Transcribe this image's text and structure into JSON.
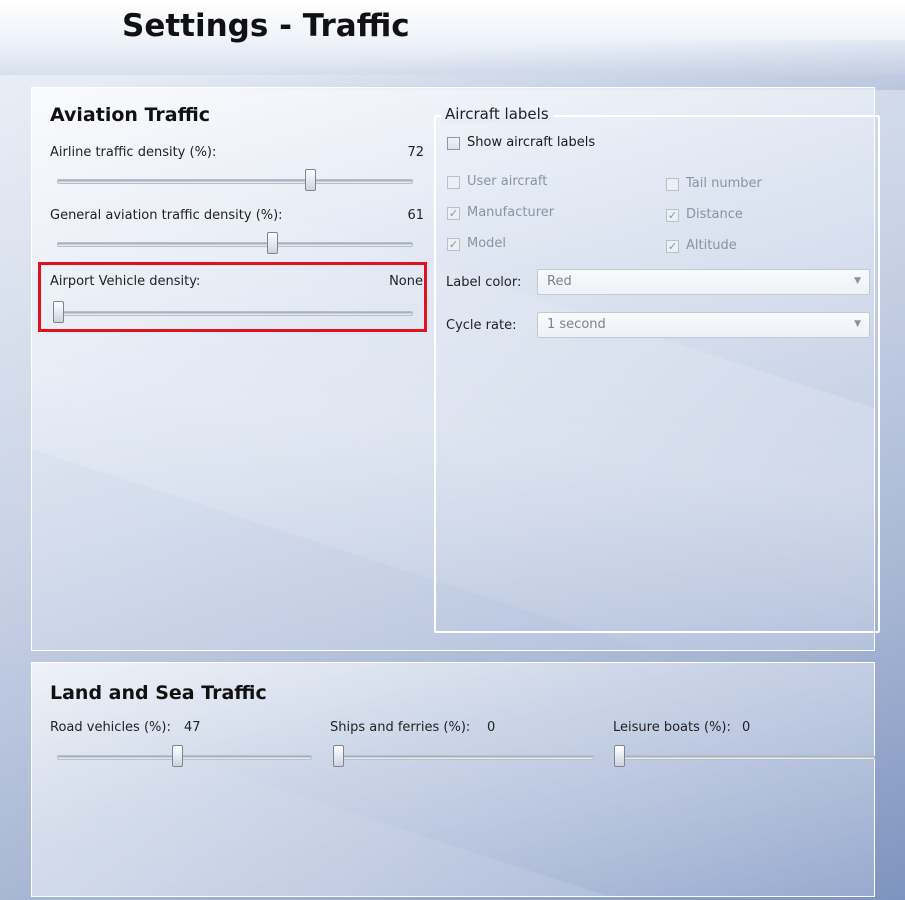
{
  "window": {
    "title": "Settings - Traffic"
  },
  "aviation": {
    "title": "Aviation Traffic",
    "airline": {
      "label": "Airline traffic density (%):",
      "value": "72",
      "level": 72
    },
    "general": {
      "label": "General aviation traffic density (%):",
      "value": "61",
      "level": 61
    },
    "airport_vehicle": {
      "label": "Airport Vehicle density:",
      "value": "None",
      "level": 0
    }
  },
  "aircraft_labels": {
    "legend": "Aircraft labels",
    "show_labels": {
      "label": "Show aircraft labels",
      "checked": false
    },
    "user_aircraft": {
      "label": "User aircraft",
      "checked": false
    },
    "tail_number": {
      "label": "Tail number",
      "checked": false
    },
    "manufacturer": {
      "label": "Manufacturer",
      "checked": true
    },
    "distance": {
      "label": "Distance",
      "checked": true
    },
    "model": {
      "label": "Model",
      "checked": true
    },
    "altitude": {
      "label": "Altitude",
      "checked": true
    },
    "label_color": {
      "label": "Label color:",
      "value": "Red"
    },
    "cycle_rate": {
      "label": "Cycle rate:",
      "value": "1 second"
    }
  },
  "land_sea": {
    "title": "Land and Sea Traffic",
    "road": {
      "label": "Road vehicles (%):",
      "value": "47",
      "level": 47
    },
    "ships": {
      "label": "Ships and ferries (%):",
      "value": "0",
      "level": 0
    },
    "leisure": {
      "label": "Leisure boats (%):",
      "value": "0",
      "level": 0
    }
  },
  "icons": {
    "checkmark": "✓",
    "dropdown_arrow": "▼"
  },
  "colors": {
    "highlight": "#e2111c"
  }
}
